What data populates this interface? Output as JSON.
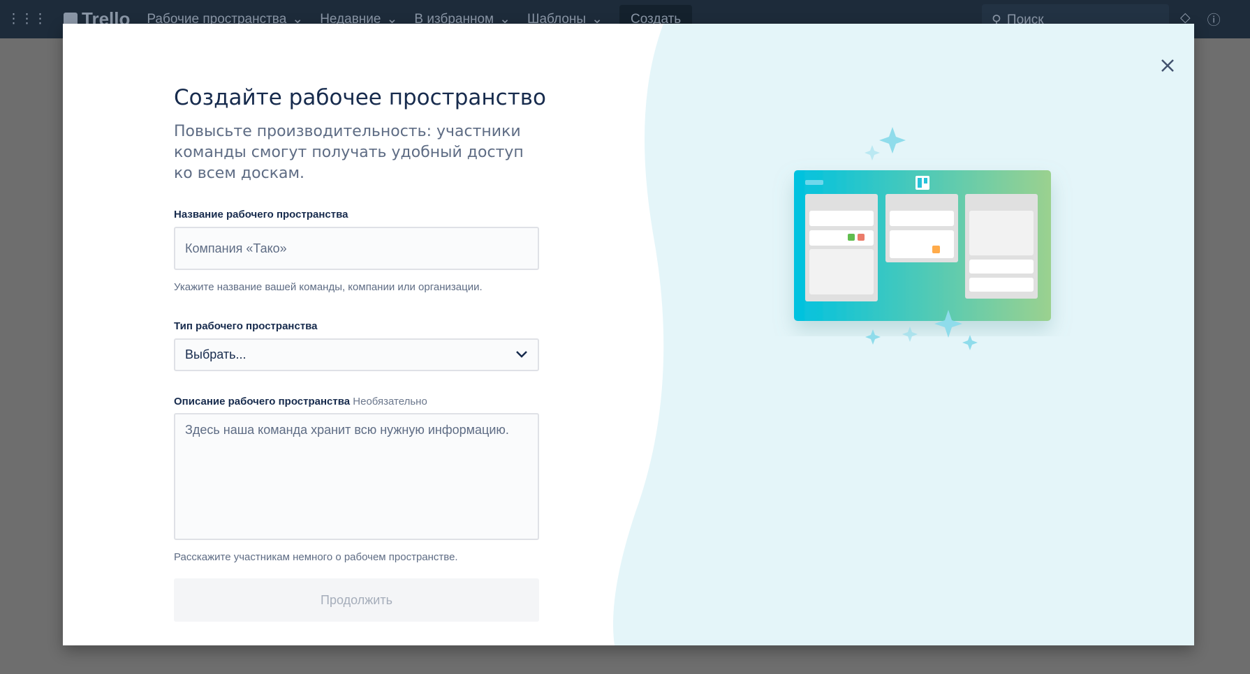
{
  "topbar": {
    "logo": "Trello",
    "nav": [
      "Рабочие пространства",
      "Недавние",
      "В избранном",
      "Шаблоны"
    ],
    "create": "Создать",
    "search_placeholder": "Поиск"
  },
  "modal": {
    "title": "Создайте рабочее пространство",
    "subtitle": "Повысьте производительность: участники команды смогут получать удобный доступ ко всем доскам.",
    "name_label": "Название рабочего пространства",
    "name_placeholder": "Компания «Тако»",
    "name_help": "Укажите название вашей команды, компании или организации.",
    "type_label": "Тип рабочего пространства",
    "type_value": "Выбрать...",
    "desc_label": "Описание рабочего пространства",
    "desc_optional": "Необязательно",
    "desc_placeholder": "Здесь наша команда хранит всю нужную информацию.",
    "desc_help": "Расскажите участникам немного о рабочем пространстве.",
    "continue": "Продолжить"
  }
}
